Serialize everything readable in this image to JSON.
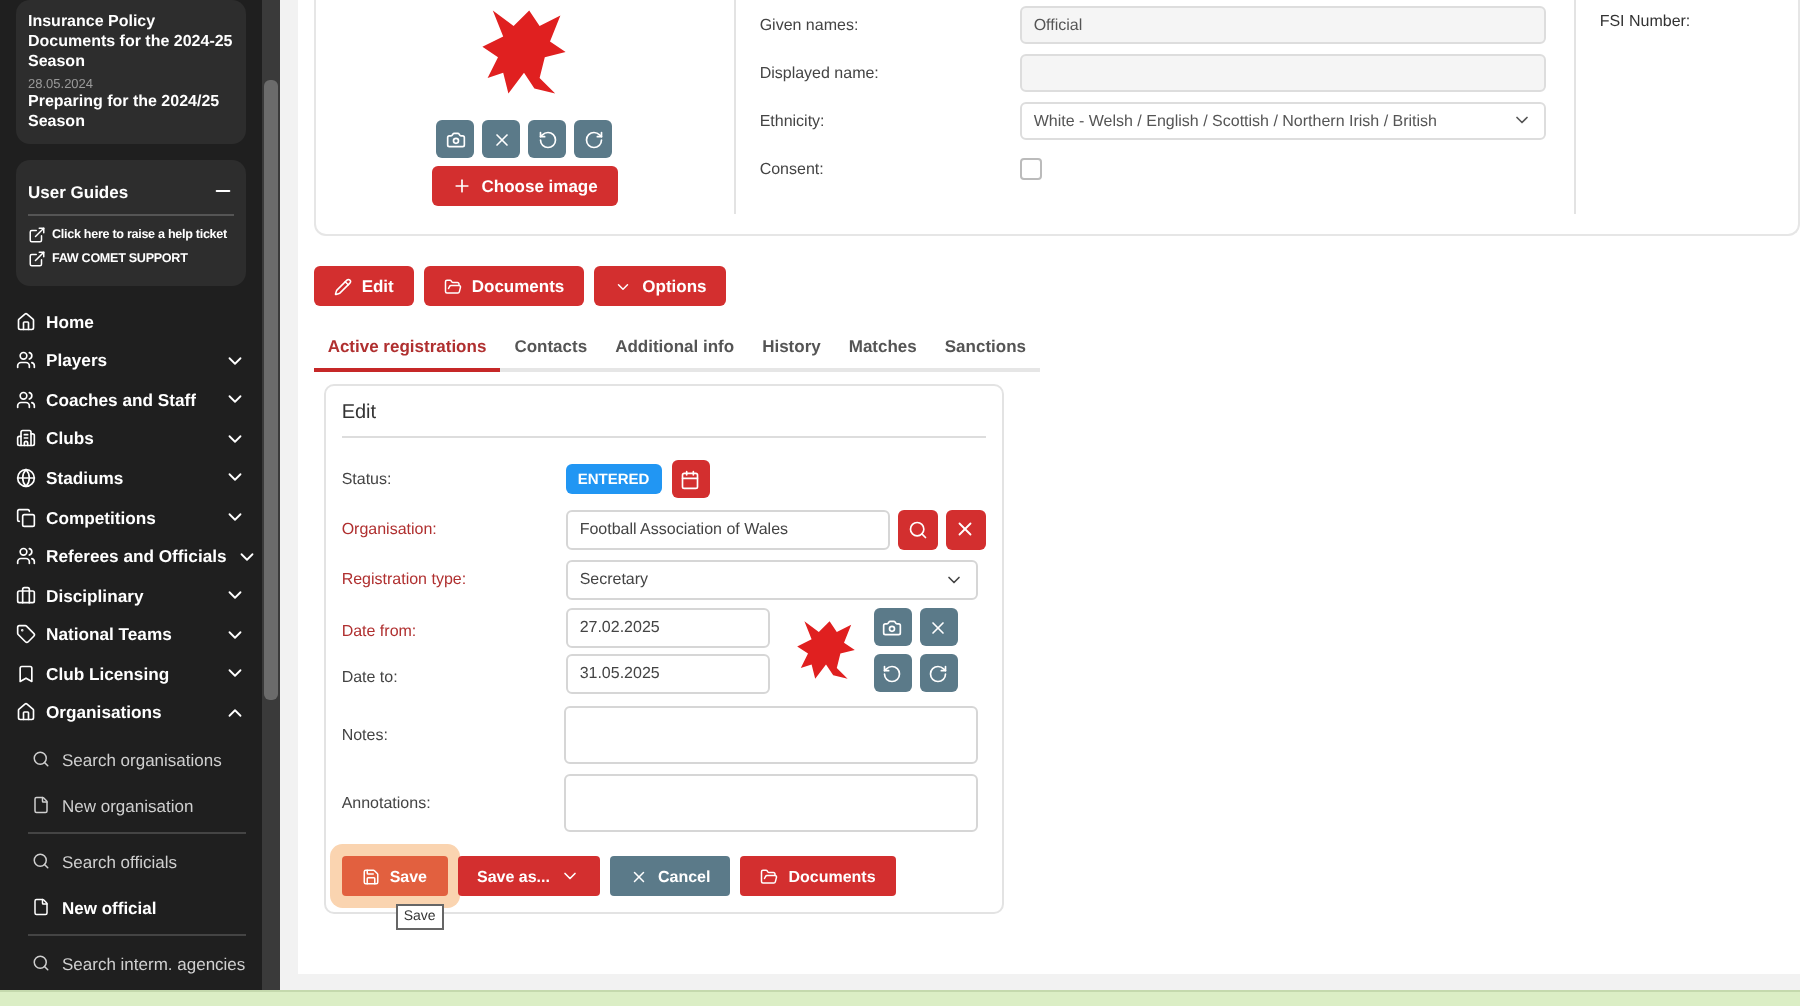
{
  "sidebar": {
    "news": [
      {
        "title": "Insurance Policy Documents for the 2024-25 Season"
      },
      {
        "date": "28.05.2024",
        "title": "Preparing for the 2024/25 Season"
      }
    ],
    "user_guides": {
      "title": "User Guides",
      "expanded": true,
      "links": [
        "Click here to raise a help ticket",
        "FAW COMET SUPPORT"
      ]
    },
    "nav": [
      {
        "label": "Home",
        "kind": "link"
      },
      {
        "label": "Players",
        "kind": "group",
        "expanded": false
      },
      {
        "label": "Coaches and Staff",
        "kind": "group",
        "expanded": false
      },
      {
        "label": "Clubs",
        "kind": "group",
        "expanded": false
      },
      {
        "label": "Stadiums",
        "kind": "group",
        "expanded": false
      },
      {
        "label": "Competitions",
        "kind": "group",
        "expanded": false
      },
      {
        "label": "Referees and Officials",
        "kind": "group",
        "expanded": false
      },
      {
        "label": "Disciplinary",
        "kind": "group",
        "expanded": false
      },
      {
        "label": "National Teams",
        "kind": "group",
        "expanded": false
      },
      {
        "label": "Club Licensing",
        "kind": "group",
        "expanded": false
      },
      {
        "label": "Organisations",
        "kind": "group",
        "expanded": true,
        "child_groups": [
          {
            "items": [
              {
                "label": "Search organisations",
                "kind": "search",
                "selected": false
              },
              {
                "label": "New organisation",
                "kind": "new",
                "selected": false
              }
            ]
          },
          {
            "items": [
              {
                "label": "Search officials",
                "kind": "search",
                "selected": false
              },
              {
                "label": "New official",
                "kind": "new",
                "selected": true
              }
            ]
          },
          {
            "items": [
              {
                "label": "Search interm. agencies",
                "kind": "search",
                "selected": false
              }
            ]
          }
        ]
      }
    ]
  },
  "photo": {
    "choose_label": "Choose image"
  },
  "person_fields": [
    {
      "label": "Given names:",
      "kind": "text",
      "value": "Official"
    },
    {
      "label": "Displayed name:",
      "kind": "text"
    },
    {
      "label": "Ethnicity:",
      "kind": "select",
      "value": "White - Welsh / English / Scottish / Northern Irish / British"
    },
    {
      "label": "Consent:",
      "kind": "checkbox",
      "checked": false
    }
  ],
  "fsi": {
    "label": "FSI Number:"
  },
  "actions": [
    {
      "label": "Edit",
      "kind": "edit"
    },
    {
      "label": "Documents",
      "kind": "documents"
    },
    {
      "label": "Options",
      "kind": "options"
    }
  ],
  "tabs": [
    {
      "label": "Active registrations",
      "selected": true
    },
    {
      "label": "Contacts",
      "selected": false
    },
    {
      "label": "Additional info",
      "selected": false
    },
    {
      "label": "History",
      "selected": false
    },
    {
      "label": "Matches",
      "selected": false
    },
    {
      "label": "Sanctions",
      "selected": false
    }
  ],
  "edit_panel": {
    "title": "Edit",
    "status": {
      "label": "Status:",
      "badge": "ENTERED"
    },
    "fields": [
      {
        "label": "Organisation:",
        "required": true,
        "kind": "lookup",
        "value": "Football Association of Wales"
      },
      {
        "label": "Registration type:",
        "required": true,
        "kind": "select",
        "value": "Secretary"
      },
      {
        "label": "Date from:",
        "required": true,
        "kind": "date",
        "value": "27.02.2025"
      },
      {
        "label": "Date to:",
        "required": false,
        "kind": "date",
        "value": "31.05.2025"
      },
      {
        "label": "Notes:",
        "required": false,
        "kind": "textarea"
      },
      {
        "label": "Annotations:",
        "required": false,
        "kind": "textarea"
      }
    ],
    "buttons": [
      {
        "label": "Save",
        "kind": "save",
        "pressed": true
      },
      {
        "label": "Save as...",
        "kind": "saveas",
        "pressed": false
      },
      {
        "label": "Cancel",
        "kind": "cancel",
        "pressed": false
      },
      {
        "label": "Documents",
        "kind": "documents",
        "pressed": false
      }
    ],
    "tooltip": "Save"
  }
}
